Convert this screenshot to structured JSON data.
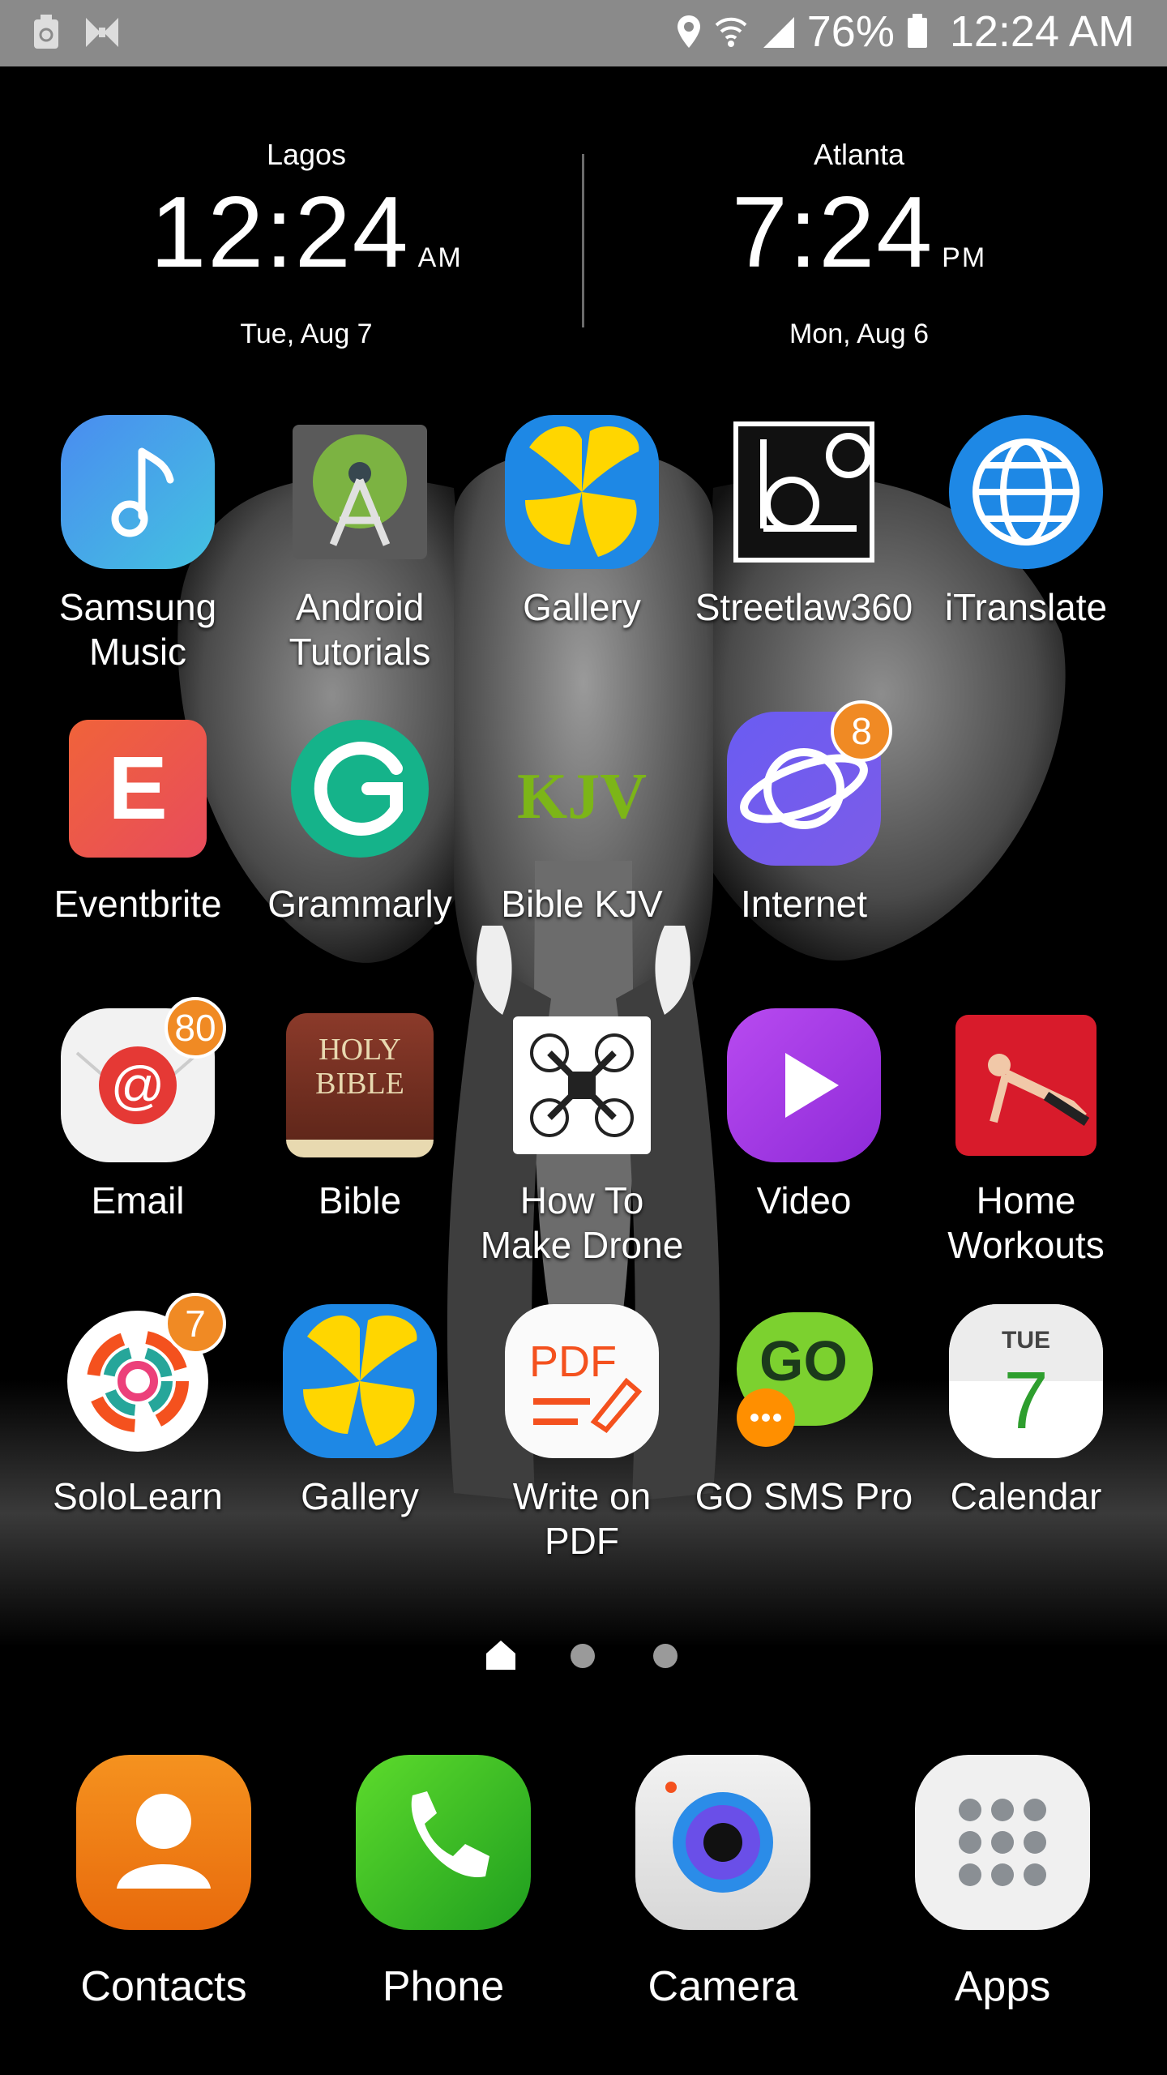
{
  "status_bar": {
    "battery_percent": "76%",
    "time": "12:24 AM"
  },
  "clocks": [
    {
      "city": "Lagos",
      "time": "12:24",
      "ampm": "AM",
      "date": "Tue, Aug 7"
    },
    {
      "city": "Atlanta",
      "time": "7:24",
      "ampm": "PM",
      "date": "Mon, Aug 6"
    }
  ],
  "apps": [
    {
      "label": "Samsung Music",
      "icon": "music-note-icon"
    },
    {
      "label": "Android Tutorials",
      "icon": "android-studio-icon"
    },
    {
      "label": "Gallery",
      "icon": "gallery-flower-icon"
    },
    {
      "label": "Streetlaw360",
      "icon": "streetlaw-icon"
    },
    {
      "label": "iTranslate",
      "icon": "globe-icon"
    },
    {
      "label": "Eventbrite",
      "icon": "eventbrite-icon"
    },
    {
      "label": "Grammarly",
      "icon": "grammarly-icon"
    },
    {
      "label": "Bible KJV",
      "icon": "kjv-icon",
      "icon_text": "KJV"
    },
    {
      "label": "Internet",
      "icon": "planet-icon",
      "badge": "8"
    },
    {
      "label": "Email",
      "icon": "email-at-icon",
      "badge": "80"
    },
    {
      "label": "Bible",
      "icon": "holy-bible-icon",
      "icon_text": "HOLY BIBLE"
    },
    {
      "label": "How To Make Drone",
      "icon": "drone-icon"
    },
    {
      "label": "Video",
      "icon": "play-icon"
    },
    {
      "label": "Home Workouts",
      "icon": "pushup-icon"
    },
    {
      "label": "SoloLearn",
      "icon": "sololearn-icon",
      "badge": "7"
    },
    {
      "label": "Gallery",
      "icon": "gallery-flower-icon"
    },
    {
      "label": "Write on PDF",
      "icon": "pdf-pen-icon",
      "icon_text": "PDF"
    },
    {
      "label": "GO SMS Pro",
      "icon": "go-sms-icon",
      "icon_text": "GO"
    },
    {
      "label": "Calendar",
      "icon": "calendar-icon",
      "icon_day": "TUE",
      "icon_date": "7"
    }
  ],
  "page_indicator": {
    "pages": 3,
    "current": 1
  },
  "dock": [
    {
      "label": "Contacts",
      "icon": "contact-person-icon"
    },
    {
      "label": "Phone",
      "icon": "phone-handset-icon"
    },
    {
      "label": "Camera",
      "icon": "camera-lens-icon"
    },
    {
      "label": "Apps",
      "icon": "app-grid-icon"
    }
  ],
  "colors": {
    "status_bar": "#8a8a8a",
    "badge": "#f08a24",
    "background": "#000000"
  }
}
